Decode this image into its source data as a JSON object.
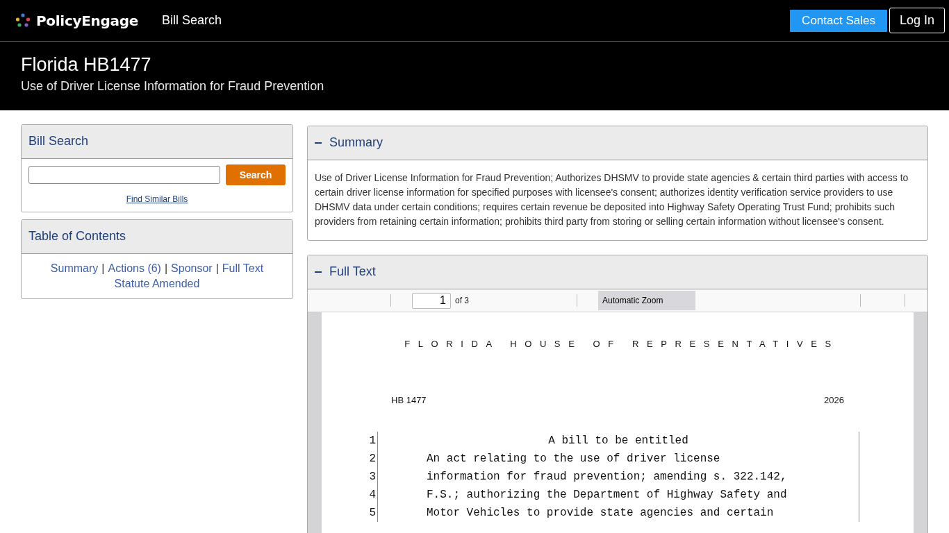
{
  "nav": {
    "brand": "PolicyEngage",
    "links": [
      "Bill Search"
    ],
    "buttons": [
      {
        "label": "Contact Sales",
        "kind": "primary"
      },
      {
        "label": "Log In",
        "kind": "outline"
      }
    ]
  },
  "bill": {
    "title": "Florida HB1477",
    "subtitle": "Use of Driver License Information for Fraud Prevention"
  },
  "sidebar": {
    "search": {
      "title": "Bill Search",
      "button": "Search",
      "link": "Find Similar Bills"
    },
    "toc": {
      "title": "Table of Contents",
      "items": [
        {
          "kind": "link",
          "text": "Summary"
        },
        {
          "kind": "separator",
          "text": "|"
        },
        {
          "kind": "link",
          "text": "Actions (6)"
        },
        {
          "kind": "separator",
          "text": "|"
        },
        {
          "kind": "link",
          "text": "Sponsor"
        },
        {
          "kind": "separator",
          "text": "|"
        },
        {
          "kind": "link",
          "text": "Full Text"
        },
        {
          "kind": "link",
          "text": "Statute Amended"
        }
      ]
    }
  },
  "sections": [
    {
      "kind": "summary",
      "title": "Summary",
      "expanded": true,
      "text": "Use of Driver License Information for Fraud Prevention; Authorizes DHSMV to provide state agencies & certain third parties with access to certain driver license information for specified purposes with licensee's consent; authorizes identity verification service providers to use DHSMV data under certain conditions; requires certain revenue be deposited into Highway Safety Operating Trust Fund; prohibits such providers from retaining certain information; prohibits third party from storing or selling certain information without licensee's consent."
    },
    {
      "kind": "viewer",
      "title": "Full Text",
      "expanded": true,
      "page_number": "1",
      "page_count": "of 3",
      "zoom": "Automatic Zoom",
      "document": {
        "heading": "FLORIDA HOUSE OF REPRESENTATIVES",
        "bill_number": "HB 1477",
        "year": "2026",
        "lines": [
          {
            "number": "1",
            "kind": "title",
            "text": "A bill to be entitled"
          },
          {
            "number": "2",
            "kind": "text",
            "text": "An act relating to the use of driver license"
          },
          {
            "number": "3",
            "kind": "text",
            "text": "information for fraud prevention; amending s. 322.142,"
          },
          {
            "number": "4",
            "kind": "text",
            "text": "F.S.; authorizing the Department of Highway Safety and"
          },
          {
            "number": "5",
            "kind": "text",
            "text": "Motor Vehicles to provide state agencies and certain"
          }
        ]
      }
    }
  ]
}
